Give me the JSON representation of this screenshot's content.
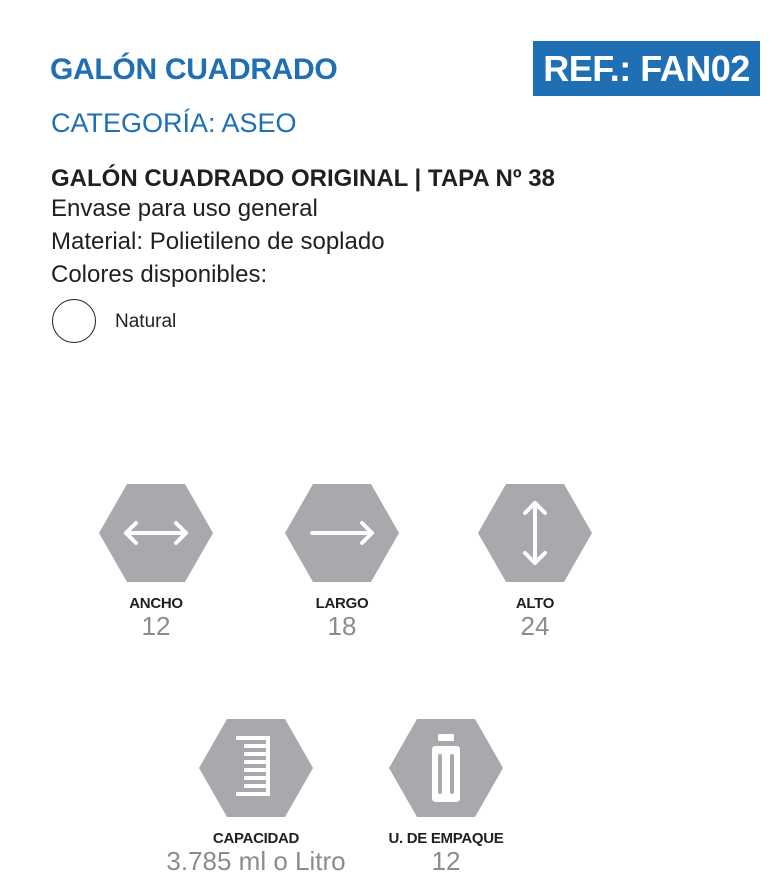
{
  "product": {
    "title": "GALÓN CUADRADO",
    "ref": "REF.: FAN02",
    "category": "CATEGORÍA: ASEO",
    "subtitle": "GALÓN CUADRADO ORIGINAL | TAPA Nº 38",
    "description": [
      "Envase para uso general",
      "Material: Polietileno de soplado",
      "Colores disponibles:"
    ],
    "colors": [
      {
        "name": "Natural",
        "swatch": "#ffffff"
      }
    ]
  },
  "specs": {
    "ancho": {
      "label": "ANCHO",
      "value": "12",
      "icon": "horizontal-double-arrow-icon"
    },
    "largo": {
      "label": "LARGO",
      "value": "18",
      "icon": "right-arrow-icon"
    },
    "alto": {
      "label": "ALTO",
      "value": "24",
      "icon": "vertical-double-arrow-icon"
    },
    "capacidad": {
      "label": "CAPACIDAD",
      "value": "3.785 ml o Litro",
      "icon": "measuring-scale-icon"
    },
    "empaque": {
      "label": "U. DE EMPAQUE",
      "value": "12",
      "icon": "bottle-icon"
    }
  },
  "colors": {
    "brand_blue": "#1f6fb5",
    "hexagon_gray": "#a7a9ac",
    "value_gray": "#8a8c8e",
    "text_dark": "#231f20"
  }
}
